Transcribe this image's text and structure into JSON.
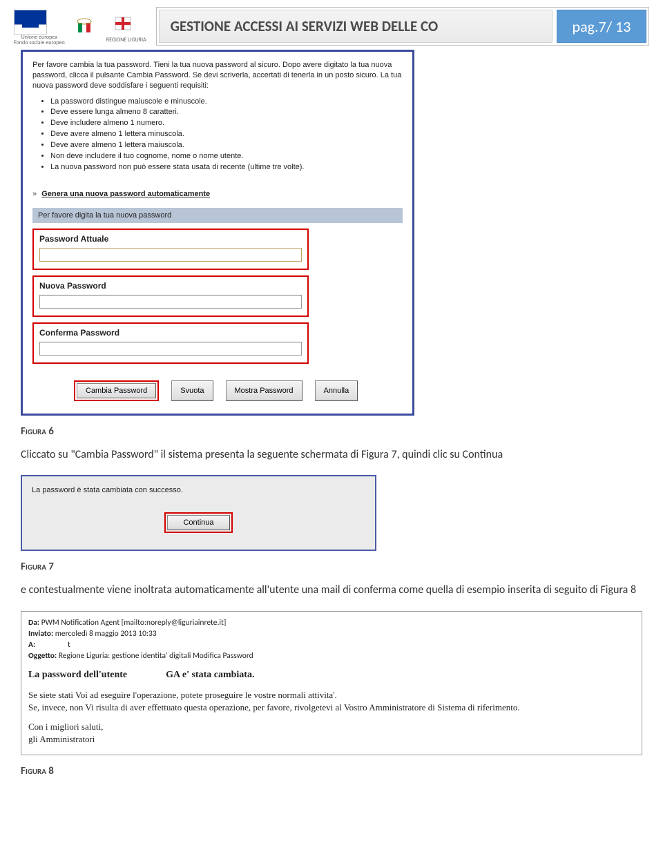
{
  "header": {
    "title": "GESTIONE ACCESSI AI SERVIZI WEB DELLE CO",
    "page": "pag.7/ 13"
  },
  "figure6": {
    "intro": "Per favore cambia la tua password. Tieni la tua nuova password al sicuro. Dopo avere digitato la tua nuova password, clicca il pulsante Cambia Password. Se devi scriverla, accertati di tenerla in un posto sicuro. La tua nuova password deve soddisfare i seguenti requisiti:",
    "requirements": [
      "La password distingue maiuscole e minuscole.",
      "Deve essere lunga almeno 8 caratteri.",
      "Deve includere almeno 1 numero.",
      "Deve avere almeno 1 lettera minuscola.",
      "Deve avere almeno 1 lettera maiuscola.",
      "Non deve includere il tuo cognome, nome o nome utente.",
      "La nuova password non può essere stata usata di recente (ultime tre volte)."
    ],
    "generate_link": "Genera una nuova password automaticamente",
    "prompt": "Per favore digita la tua nuova password",
    "label_current": "Password Attuale",
    "label_new": "Nuova Password",
    "label_confirm": "Conferma Password",
    "btn_change": "Cambia Password",
    "btn_clear": "Svuota",
    "btn_show": "Mostra Password",
    "btn_cancel": "Annulla"
  },
  "captions": {
    "fig6": "Figura 6",
    "fig7": "Figura 7",
    "fig8": "Figura 8"
  },
  "text1": "Cliccato su \"Cambia Password\" il sistema presenta la seguente schermata di Figura 7, quindi clic su Continua",
  "figure7": {
    "msg": "La password è stata cambiata con successo.",
    "btn": "Continua"
  },
  "text2": "e contestualmente viene inoltrata automaticamente all'utente una mail di conferma come quella di esempio inserita di seguito di Figura 8",
  "figure8": {
    "from_label": "Da:",
    "from_value": "PWM Notification Agent [mailto:noreply@liguriainrete.it]",
    "sent_label": "Inviato:",
    "sent_value": "mercoledì 8 maggio 2013 10:33",
    "to_label": "A:",
    "subject_label": "Oggetto:",
    "subject_value": "Regione Liguria: gestione identita' digitali Modifica Password",
    "changed_line": "La password dell'utente                GA e' stata cambiata.",
    "para1": "Se siete stati Voi ad eseguire l'operazione, potete proseguire le vostre normali attivita'.",
    "para2": "Se, invece, non Vi risulta di aver effettuato questa operazione, per favore, rivolgetevi al Vostro Amministratore di Sistema di riferimento.",
    "sign1": "Con i migliori saluti,",
    "sign2": "gli Amministratori"
  }
}
